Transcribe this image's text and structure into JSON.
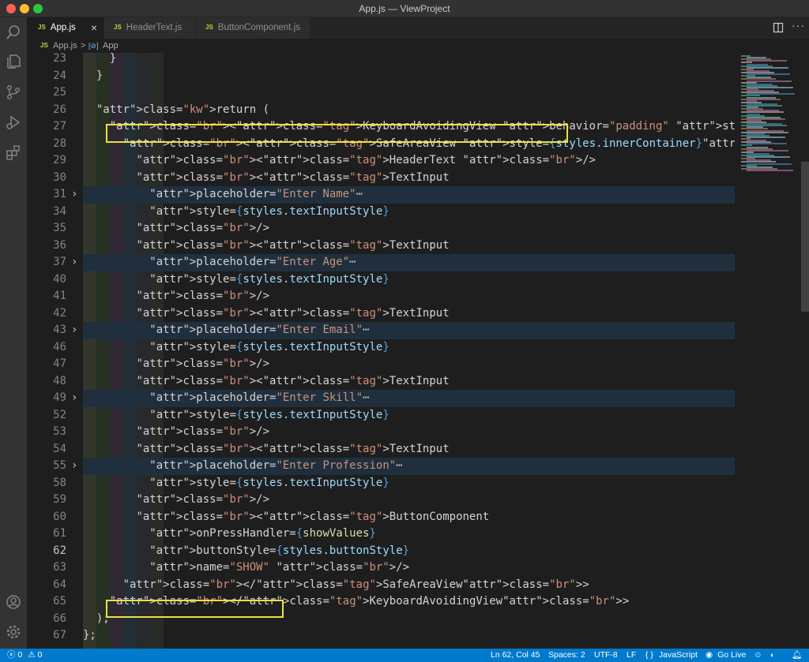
{
  "window": {
    "title": "App.js — ViewProject",
    "traffic_colors": [
      "#ff5f57",
      "#febc2e",
      "#28c840"
    ]
  },
  "activity_bar": {
    "icons": [
      "search-icon",
      "files-icon",
      "source-control-icon",
      "run-debug-icon",
      "extensions-icon",
      "account-icon",
      "settings-gear-icon"
    ]
  },
  "tabs": [
    {
      "label": "App.js",
      "badge": "JS",
      "active": true,
      "close": "×"
    },
    {
      "label": "HeaderText.js",
      "badge": "JS",
      "active": false
    },
    {
      "label": "ButtonComponent.js",
      "badge": "JS",
      "active": false
    }
  ],
  "editor_actions": [
    "split-editor-icon",
    "more-actions-icon"
  ],
  "breadcrumb": {
    "badge": "JS",
    "file": "App.js",
    "separator": ">",
    "symbol_icon": "[⊘]",
    "symbol": "App"
  },
  "editor": {
    "current_line": "62",
    "lines": [
      {
        "num": "23",
        "text": "    }"
      },
      {
        "num": "24",
        "text": "  }"
      },
      {
        "num": "25",
        "text": ""
      },
      {
        "num": "26",
        "text": "  return ("
      },
      {
        "num": "27",
        "text": "    <KeyboardAvoidingView behavior=\"padding\" style={styles.container}>"
      },
      {
        "num": "28",
        "text": "      <SafeAreaView style={styles.innerContainer}>"
      },
      {
        "num": "29",
        "text": "        <HeaderText />"
      },
      {
        "num": "30",
        "text": "        <TextInput"
      },
      {
        "num": "31",
        "text": "          placeholder=\"Enter Name\"…",
        "folded": true
      },
      {
        "num": "34",
        "text": "          style={styles.textInputStyle}"
      },
      {
        "num": "35",
        "text": "        />"
      },
      {
        "num": "36",
        "text": "        <TextInput"
      },
      {
        "num": "37",
        "text": "          placeholder=\"Enter Age\"…",
        "folded": true
      },
      {
        "num": "40",
        "text": "          style={styles.textInputStyle}"
      },
      {
        "num": "41",
        "text": "        />"
      },
      {
        "num": "42",
        "text": "        <TextInput"
      },
      {
        "num": "43",
        "text": "          placeholder=\"Enter Email\"…",
        "folded": true
      },
      {
        "num": "46",
        "text": "          style={styles.textInputStyle}"
      },
      {
        "num": "47",
        "text": "        />"
      },
      {
        "num": "48",
        "text": "        <TextInput"
      },
      {
        "num": "49",
        "text": "          placeholder=\"Enter Skill\"…",
        "folded": true
      },
      {
        "num": "52",
        "text": "          style={styles.textInputStyle}"
      },
      {
        "num": "53",
        "text": "        />"
      },
      {
        "num": "54",
        "text": "        <TextInput"
      },
      {
        "num": "55",
        "text": "          placeholder=\"Enter Profession\"…",
        "folded": true
      },
      {
        "num": "58",
        "text": "          style={styles.textInputStyle}"
      },
      {
        "num": "59",
        "text": "        />"
      },
      {
        "num": "60",
        "text": "        <ButtonComponent"
      },
      {
        "num": "61",
        "text": "          onPressHandler={showValues}"
      },
      {
        "num": "62",
        "text": "          buttonStyle={styles.buttonStyle}"
      },
      {
        "num": "63",
        "text": "          name=\"SHOW\" />"
      },
      {
        "num": "64",
        "text": "      </SafeAreaView>"
      },
      {
        "num": "65",
        "text": "    </KeyboardAvoidingView>"
      },
      {
        "num": "66",
        "text": "  );"
      },
      {
        "num": "67",
        "text": "};"
      }
    ]
  },
  "status_bar": {
    "problems": "0",
    "warnings": "0",
    "position": "Ln 62, Col 45",
    "spaces": "Spaces: 2",
    "encoding": "UTF-8",
    "eol": "LF",
    "language_icon": "{ }",
    "language": "JavaScript",
    "go_live": "Go Live",
    "icons": [
      "error-icon",
      "warning-icon",
      "go-live-icon",
      "accounts-icon",
      "bell-icon"
    ]
  },
  "colors": {
    "status_bar": "#007acc",
    "highlight_box": "#f0e040",
    "editor_bg": "#1e1e1e"
  }
}
